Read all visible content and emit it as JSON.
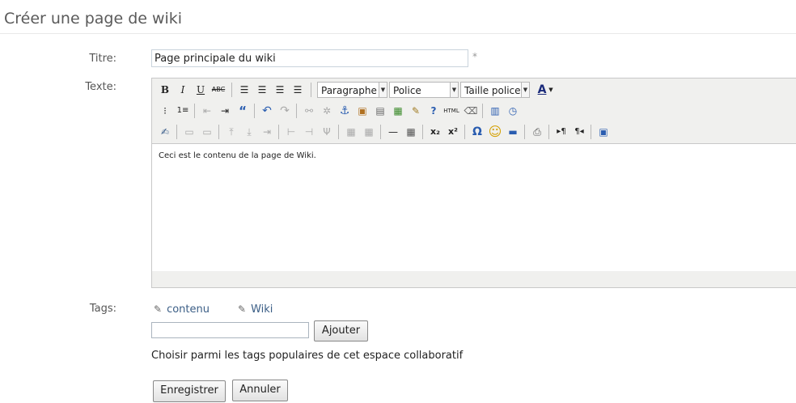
{
  "page": {
    "title": "Créer une page de wiki"
  },
  "form": {
    "title_label": "Titre:",
    "title_value": "Page principale du wiki",
    "required_mark": "*",
    "text_label": "Texte:",
    "tags_label": "Tags:",
    "tag_input_value": "",
    "add_button": "Ajouter",
    "popular_tags_hint": "Choisir parmi les tags populaires de cet espace collaboratif",
    "save_button": "Enregistrer",
    "cancel_button": "Annuler"
  },
  "editor": {
    "content": "Ceci est le contenu de la page de Wiki.",
    "format_select": "Paragraphe",
    "font_select": "Police",
    "size_select": "Taille police",
    "bold": "B",
    "italic": "I",
    "underline": "U",
    "strike": "ABC",
    "font_color": "A",
    "html_label": "HTML",
    "subscript": "x₂",
    "superscript": "x²",
    "omega": "Ω"
  },
  "tags": [
    {
      "label": "contenu"
    },
    {
      "label": "Wiki"
    }
  ],
  "colors": {
    "link": "#3b5e86",
    "toolbar_bg": "#f0f0ee"
  }
}
